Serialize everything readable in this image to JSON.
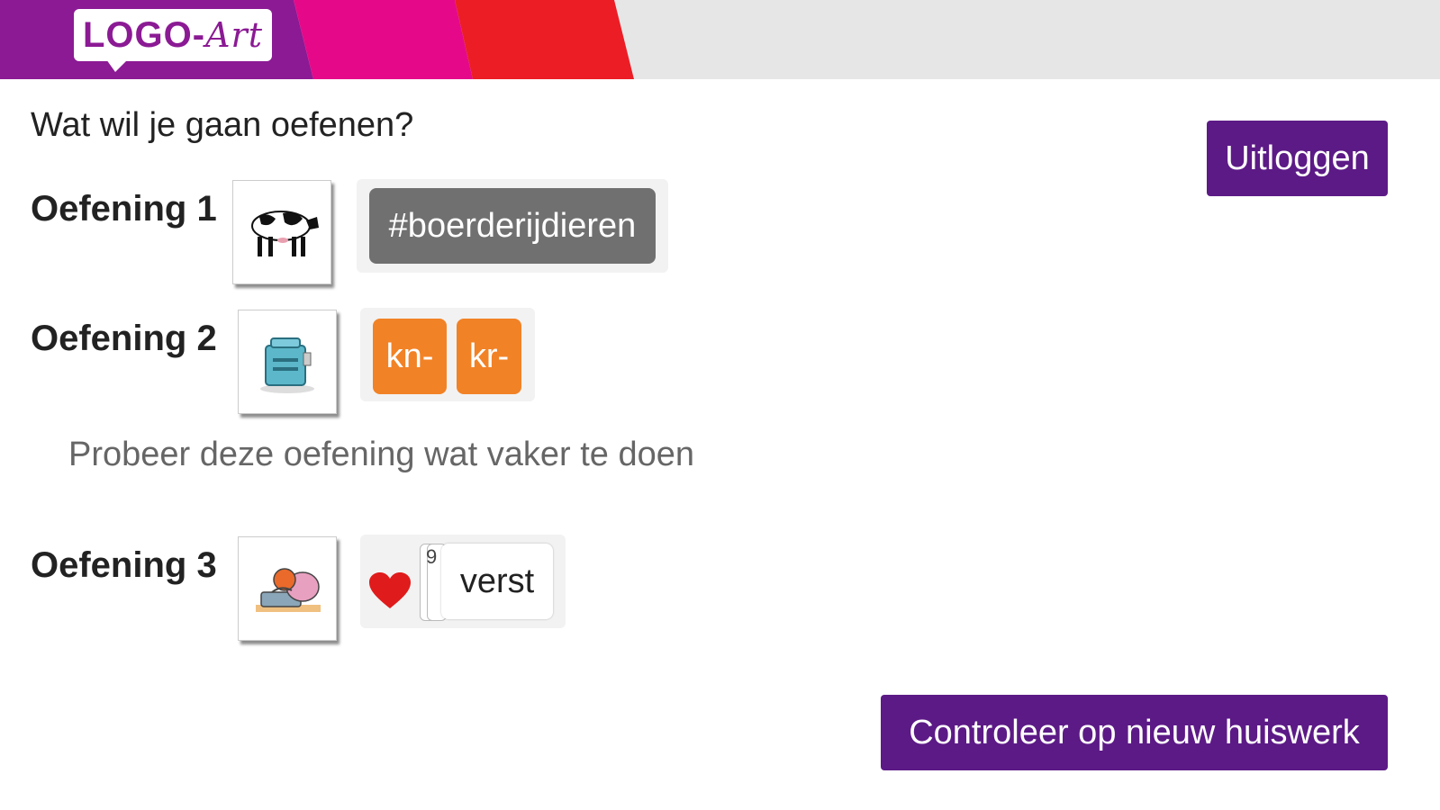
{
  "header": {
    "logo_main": "LOGO-",
    "logo_accent": "Art",
    "colors": [
      "#8b1a94",
      "#e5098a",
      "#ec1d25",
      "#e6e6e6"
    ]
  },
  "main": {
    "question": "Wat wil je gaan oefenen?",
    "logout_label": "Uitloggen",
    "check_label": "Controleer op nieuw huiswerk"
  },
  "exercises": [
    {
      "label": "Oefening 1",
      "image": "cow-picture",
      "tags": [
        "#boerderijdieren"
      ]
    },
    {
      "label": "Oefening 2",
      "image": "toaster-picture",
      "tags": [
        "kn-",
        "kr-"
      ],
      "hint": "Probeer deze oefening wat vaker te doen"
    },
    {
      "label": "Oefening 3",
      "image": "person-at-table-picture",
      "favorite_icon": "heart-icon",
      "stack_count": "9",
      "word": "verst"
    }
  ],
  "colors": {
    "purple_button": "#5c1a86",
    "orange_tag": "#f28226",
    "grey_tag": "#707070",
    "heart": "#e01b1b"
  }
}
